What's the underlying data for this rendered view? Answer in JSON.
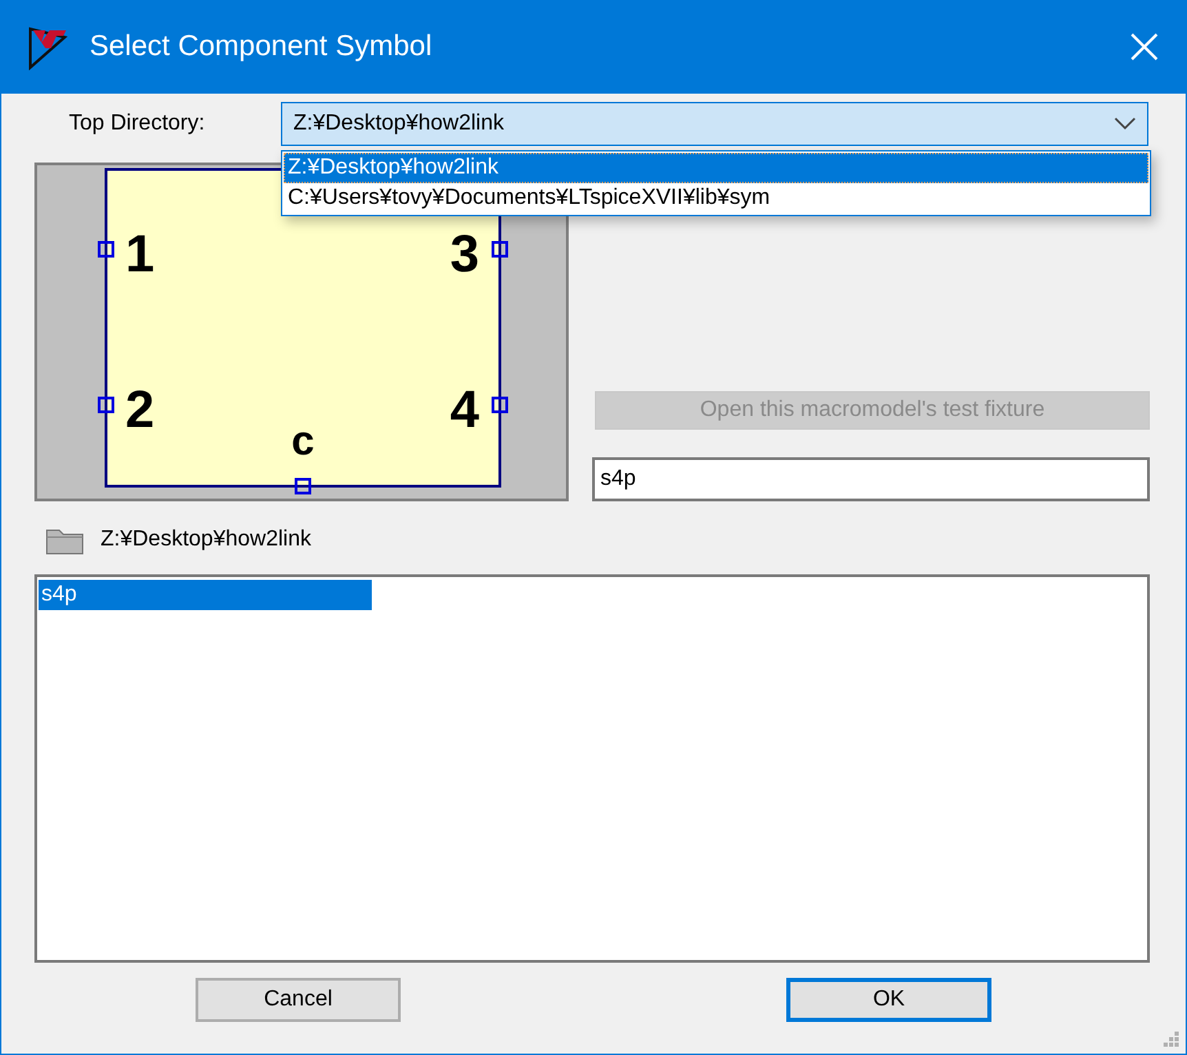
{
  "window": {
    "title": "Select Component Symbol"
  },
  "top_directory": {
    "label": "Top Directory:",
    "value": "Z:¥Desktop¥how2link",
    "expanded": true,
    "options": [
      {
        "label": "Z:¥Desktop¥how2link",
        "selected": true
      },
      {
        "label": "C:¥Users¥tovy¥Documents¥LTspiceXVII¥lib¥sym",
        "selected": false
      }
    ]
  },
  "preview": {
    "pins": [
      {
        "label": "1"
      },
      {
        "label": "2"
      },
      {
        "label": "3"
      },
      {
        "label": "4"
      },
      {
        "label": "c"
      }
    ]
  },
  "test_fixture_button": {
    "label": "Open this macromodel's test fixture",
    "disabled": true
  },
  "name_field": {
    "value": "s4p"
  },
  "current_folder": "Z:¥Desktop¥how2link",
  "files": [
    {
      "name": "s4p",
      "selected": true
    }
  ],
  "buttons": [
    {
      "label": "Cancel",
      "default": false
    },
    {
      "label": "OK",
      "default": true
    }
  ]
}
